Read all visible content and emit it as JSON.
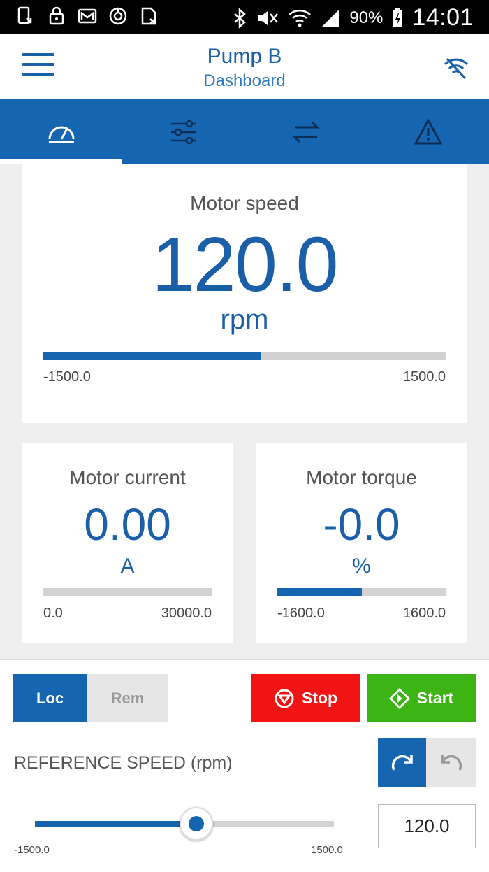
{
  "status_bar": {
    "battery_percent": "90%",
    "time": "14:01",
    "icons": [
      "download-icon",
      "lock-icon",
      "mail-icon",
      "sync-icon",
      "sim-icon",
      "bluetooth-icon",
      "mute-icon",
      "wifi-icon",
      "signal-icon",
      "battery-icon"
    ]
  },
  "app_bar": {
    "title": "Pump B",
    "subtitle": "Dashboard"
  },
  "tabs": [
    {
      "id": "dashboard",
      "icon": "speedometer-icon",
      "active": true
    },
    {
      "id": "parameters",
      "icon": "sliders-icon",
      "active": false
    },
    {
      "id": "transfer",
      "icon": "swap-arrows-icon",
      "active": false
    },
    {
      "id": "alarms",
      "icon": "warning-icon",
      "active": false
    }
  ],
  "motor_speed": {
    "label": "Motor speed",
    "value": "120.0",
    "unit": "rpm",
    "min": "-1500.0",
    "max": "1500.0",
    "bar_fraction": 0.54
  },
  "motor_current": {
    "label": "Motor current",
    "value": "0.00",
    "unit": "A",
    "min": "0.0",
    "max": "30000.0",
    "bar_fraction": 0.0
  },
  "motor_torque": {
    "label": "Motor torque",
    "value": "-0.0",
    "unit": "%",
    "min": "-1600.0",
    "max": "1600.0",
    "bar_fraction": 0.5
  },
  "controls": {
    "loc_label": "Loc",
    "rem_label": "Rem",
    "stop_label": "Stop",
    "start_label": "Start",
    "reference_label": "REFERENCE SPEED (rpm)",
    "slider_min": "-1500.0",
    "slider_max": "1500.0",
    "slider_fraction": 0.54,
    "reference_value": "120.0"
  },
  "colors": {
    "primary": "#1565b0",
    "stop": "#f01414",
    "start": "#3cb514"
  }
}
